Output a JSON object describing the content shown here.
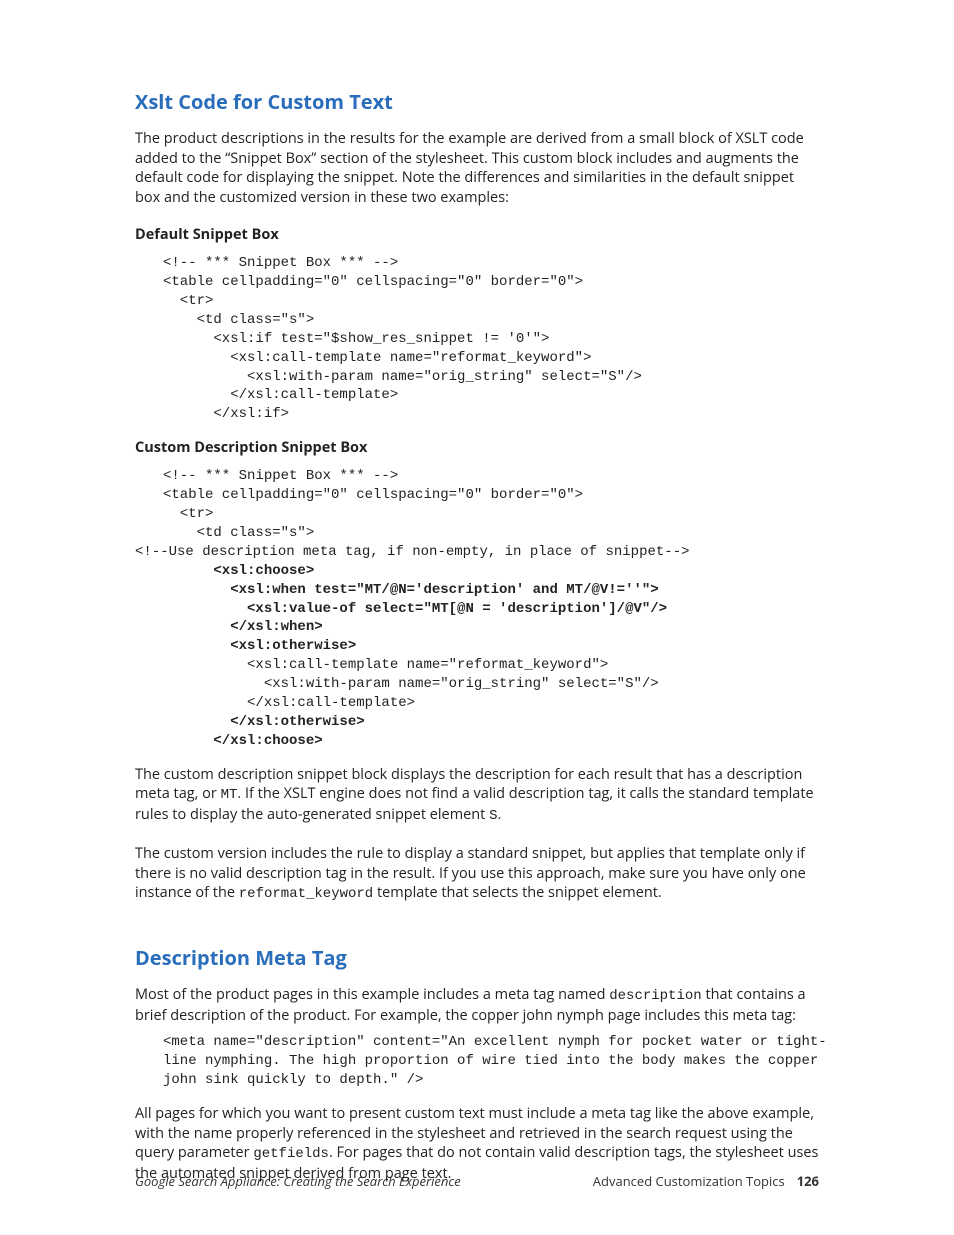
{
  "section1": {
    "heading": "Xslt Code for Custom Text",
    "intro": "The product descriptions in the results for the example are derived from a small block of XSLT code added to the “Snippet Box” section of the stylesheet. This custom block includes and augments the default code for displaying the snippet. Note the differences and similarities in the default snippet box and the customized version in these two examples:",
    "sub1": "Default Snippet Box",
    "code1": "<!-- *** Snippet Box *** -->\n<table cellpadding=\"0\" cellspacing=\"0\" border=\"0\">\n  <tr>\n    <td class=\"s\">\n      <xsl:if test=\"$show_res_snippet != '0'\">\n        <xsl:call-template name=\"reformat_keyword\">\n          <xsl:with-param name=\"orig_string\" select=\"S\"/>\n        </xsl:call-template>\n      </xsl:if>",
    "sub2": "Custom Description Snippet Box",
    "code2_plain_a": "<!-- *** Snippet Box *** -->\n<table cellpadding=\"0\" cellspacing=\"0\" border=\"0\">\n  <tr>\n    <td class=\"s\">",
    "code2_comment": "<!--Use description meta tag, if non-empty, in place of snippet-->",
    "code2_b1": "      <xsl:choose>",
    "code2_b2": "        <xsl:when test=\"MT/@N='description' and MT/@V!=''\">",
    "code2_b3": "          <xsl:value-of select=\"MT[@N = 'description']/@V\"/>",
    "code2_b4": "        </xsl:when>",
    "code2_b5": "        <xsl:otherwise>",
    "code2_plain_b": "          <xsl:call-template name=\"reformat_keyword\">\n            <xsl:with-param name=\"orig_string\" select=\"S\"/>\n          </xsl:call-template>",
    "code2_b6": "        </xsl:otherwise>",
    "code2_b7": "      </xsl:choose>",
    "para2_a": "The custom description snippet block displays the description for each result that has a description meta tag, or ",
    "para2_code1": "MT",
    "para2_b": ". If the XSLT engine does not find a valid description tag, it calls the standard template rules to display the auto-generated snippet element ",
    "para2_code2": "S",
    "para2_c": ".",
    "para3_a": "The custom version includes the rule to display a standard snippet, but applies that template only if there is no valid description tag in the result. If you use this approach, make sure you have only one instance of the ",
    "para3_code": "reformat_keyword",
    "para3_b": " template that selects the snippet element."
  },
  "section2": {
    "heading": "Description Meta Tag",
    "para1_a": "Most of the product pages in this example includes a meta tag named ",
    "para1_code": "description",
    "para1_b": " that contains a brief description of the product. For example, the copper john nymph page includes this meta tag:",
    "code": "<meta name=\"description\" content=\"An excellent nymph for pocket water or tight-\nline nymphing. The high proportion of wire tied into the body makes the copper\njohn sink quickly to depth.\" />",
    "para2_a": "All pages for which you want to present custom text must include a meta tag like the above example, with the name properly referenced in the stylesheet and retrieved in the search request using the query parameter ",
    "para2_code": "getfields",
    "para2_b": ". For pages that do not contain valid description tags, the stylesheet uses the automated snippet derived from page text."
  },
  "footer": {
    "left": "Google Search Appliance: Creating the Search Experience",
    "right_label": "Advanced Customization Topics",
    "page_num": "126"
  }
}
